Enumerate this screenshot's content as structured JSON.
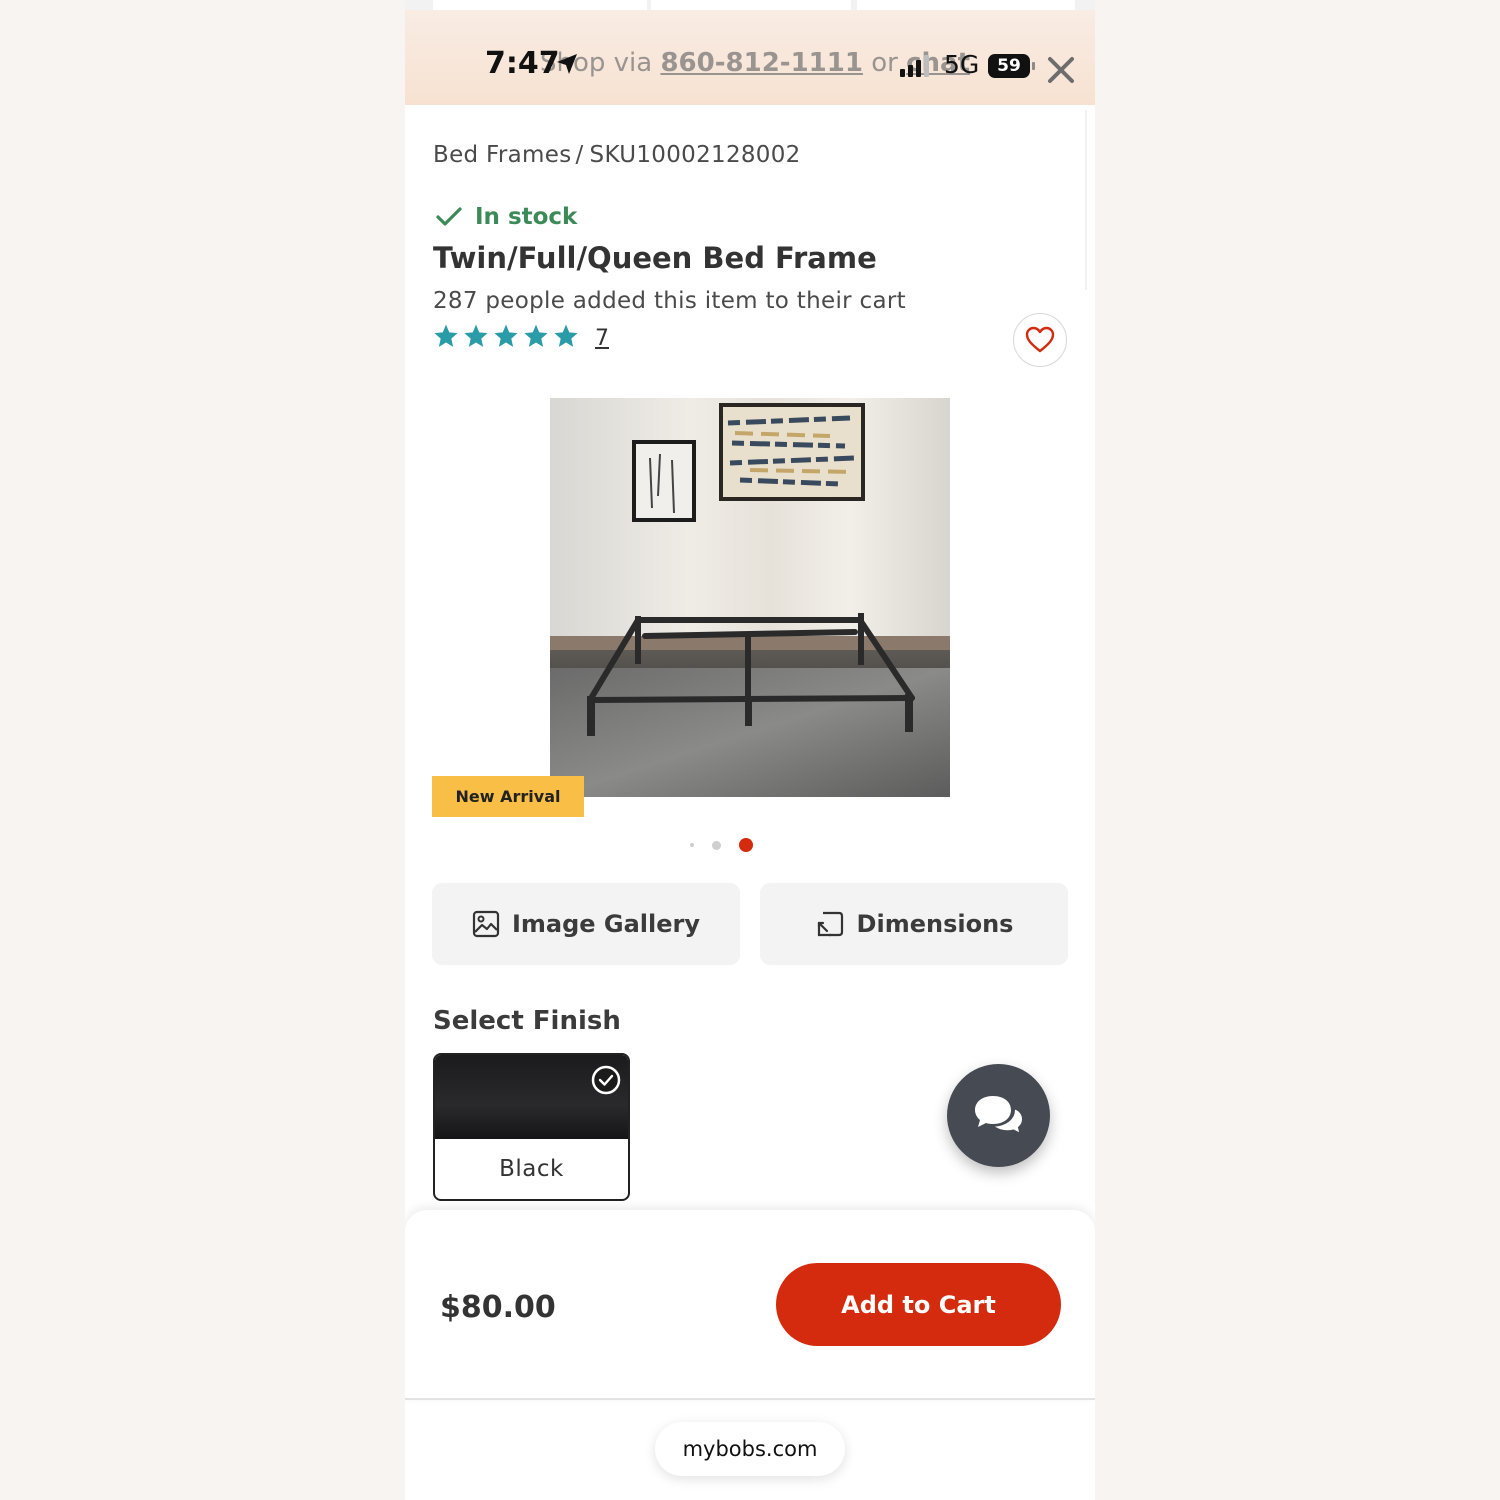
{
  "status_bar": {
    "time": "7:47",
    "network": "5G",
    "battery": "59"
  },
  "banner": {
    "prefix": "Shop via ",
    "phone": "860-812-1111",
    "middle": " or ",
    "chat": "chat"
  },
  "breadcrumb": {
    "category": "Bed Frames",
    "separator": "/",
    "sku": "SKU10002128002"
  },
  "product": {
    "stock_status": "In stock",
    "title": "Twin/Full/Queen Bed Frame",
    "cart_count_text": "287 people added this item to their cart",
    "rating_stars": 5,
    "review_count": "7",
    "badge": "New Arrival",
    "carousel": {
      "total": 3,
      "active_index": 2
    }
  },
  "actions": {
    "gallery_label": "Image Gallery",
    "dimensions_label": "Dimensions"
  },
  "finish": {
    "heading": "Select Finish",
    "options": [
      {
        "label": "Black",
        "selected": true
      }
    ]
  },
  "purchase": {
    "price": "$80.00",
    "add_to_cart_label": "Add to Cart"
  },
  "browser": {
    "url": "mybobs.com"
  },
  "colors": {
    "accent_red": "#d42a0d",
    "stock_green": "#3b8a57",
    "star_teal": "#2a9ca7",
    "badge_yellow": "#f8be46"
  },
  "icons": [
    "location-arrow-icon",
    "signal-icon",
    "close-icon",
    "checkmark-icon",
    "star-icon",
    "heart-icon",
    "image-icon",
    "dimensions-icon",
    "selected-check-icon",
    "chat-bubbles-icon"
  ]
}
